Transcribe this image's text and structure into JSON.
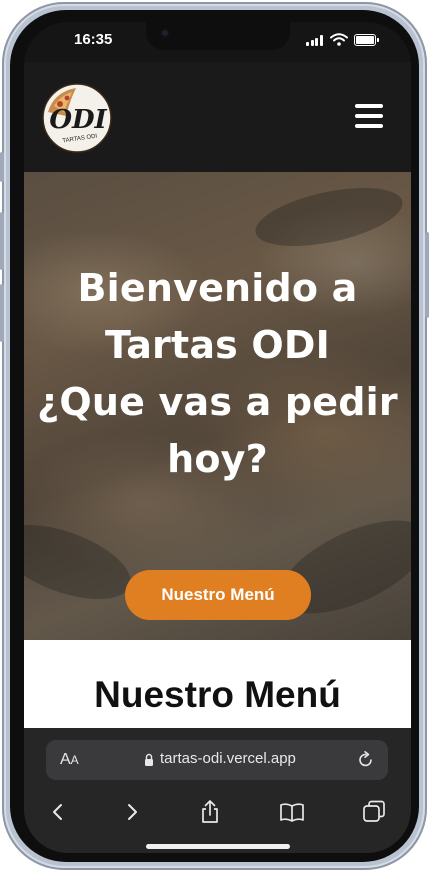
{
  "status_bar": {
    "time": "16:35"
  },
  "navbar": {
    "logo_text": "ODI",
    "logo_subtext": "TARTAS ODI"
  },
  "hero": {
    "title_lines": [
      "Bienvenido a",
      "Tartas ODI",
      "¿Que vas a pedir",
      "hoy?"
    ],
    "cta_label": "Nuestro Menú"
  },
  "menu_section": {
    "heading": "Nuestro Menú"
  },
  "safari": {
    "text_size_label": "AA",
    "url": "tartas-odi.vercel.app"
  },
  "colors": {
    "accent": "#e07f22",
    "navbar_bg": "#1a1a1a",
    "url_bar_bg": "#3a3a3c"
  },
  "icons": [
    "cellular-signal-icon",
    "wifi-icon",
    "battery-icon",
    "hamburger-menu-icon",
    "lock-icon",
    "reload-icon",
    "back-icon",
    "forward-icon",
    "share-icon",
    "bookmarks-icon",
    "tabs-icon"
  ]
}
